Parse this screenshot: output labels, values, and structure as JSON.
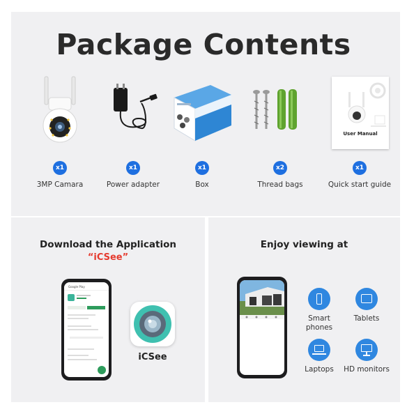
{
  "title": "Package Contents",
  "items": [
    {
      "qty": "x1",
      "label": "3MP Camara"
    },
    {
      "qty": "x1",
      "label": "Power adapter"
    },
    {
      "qty": "x1",
      "label": "Box"
    },
    {
      "qty": "x2",
      "label": "Thread bags"
    },
    {
      "qty": "x1",
      "label": "Quick start guide"
    }
  ],
  "manual_cover_text": "User Manual",
  "download": {
    "heading": "Download the Application",
    "app_name_quoted": "“iCSee”",
    "app_label": "iCSee",
    "phone_store_title": "Google Play"
  },
  "viewing": {
    "heading": "Enjoy viewing at",
    "devices": [
      {
        "label": "Smart phones",
        "icon": "smartphone-icon"
      },
      {
        "label": "Tablets",
        "icon": "tablet-icon"
      },
      {
        "label": "Laptops",
        "icon": "laptop-icon"
      },
      {
        "label": "HD monitors",
        "icon": "monitor-icon"
      }
    ]
  },
  "colors": {
    "badge": "#1e6fe0",
    "accent_red": "#e53a2e",
    "device_circle": "#2f87e0",
    "panel": "#f0f0f2"
  }
}
